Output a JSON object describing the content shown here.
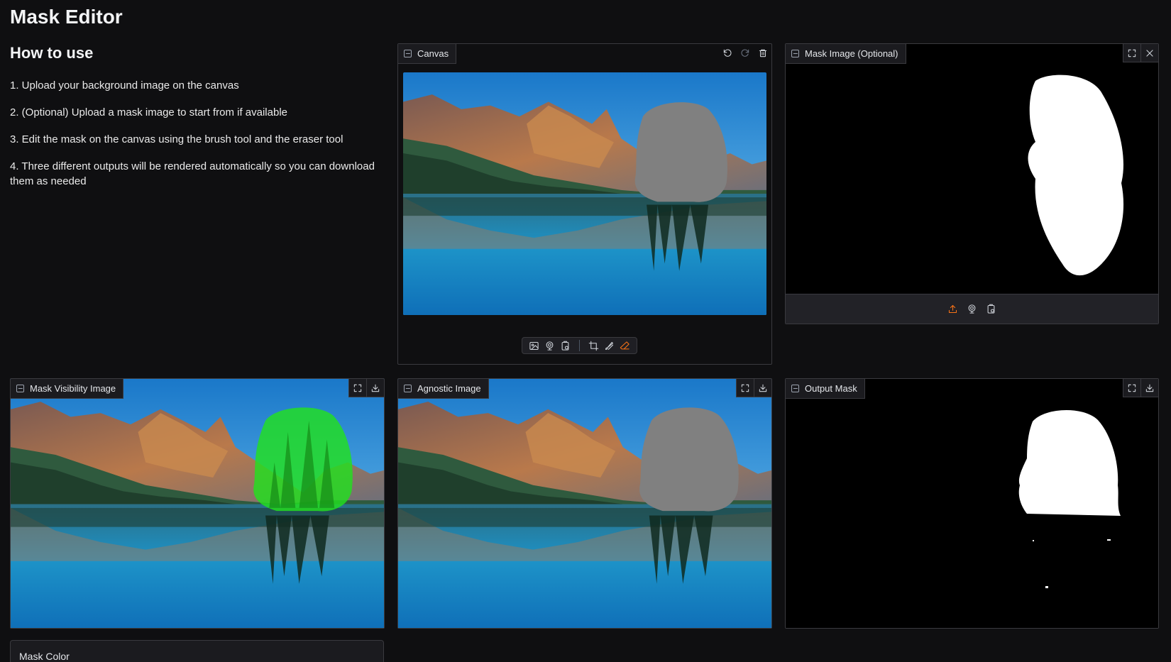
{
  "app": {
    "title": "Mask Editor"
  },
  "howto": {
    "heading": "How to use",
    "steps": [
      "1. Upload your background image on the canvas",
      "2. (Optional) Upload a mask image to start from if available",
      "3. Edit the mask on the canvas using the brush tool and the eraser tool",
      "4. Three different outputs will be rendered automatically so you can download them as needed"
    ]
  },
  "panels": {
    "canvas": {
      "label": "Canvas",
      "actions": [
        "undo-icon",
        "redo-icon",
        "trash-icon"
      ]
    },
    "mask_image": {
      "label": "Mask Image (Optional)",
      "actions": [
        "fullscreen-icon",
        "close-icon"
      ],
      "upload_sources": [
        "upload-icon",
        "webcam-icon",
        "clipboard-icon"
      ]
    },
    "mask_visibility": {
      "label": "Mask Visibility Image",
      "actions": [
        "fullscreen-icon",
        "download-icon"
      ]
    },
    "agnostic": {
      "label": "Agnostic Image",
      "actions": [
        "fullscreen-icon",
        "download-icon"
      ]
    },
    "output_mask": {
      "label": "Output Mask",
      "actions": [
        "fullscreen-icon",
        "download-icon"
      ]
    }
  },
  "canvas_toolbar": {
    "sources": [
      "image-icon",
      "webcam-icon",
      "clipboard-icon"
    ],
    "tools": [
      "crop-icon",
      "brush-icon",
      "eraser-icon"
    ],
    "active_tool": "eraser-icon"
  },
  "mask_color": {
    "label": "Mask Color"
  },
  "colors": {
    "background": "#0f0f11",
    "panel_border": "#3a3a3f",
    "accent": "#f97316",
    "mask_overlay": "#22e01f",
    "mask_fill": "#808080"
  }
}
